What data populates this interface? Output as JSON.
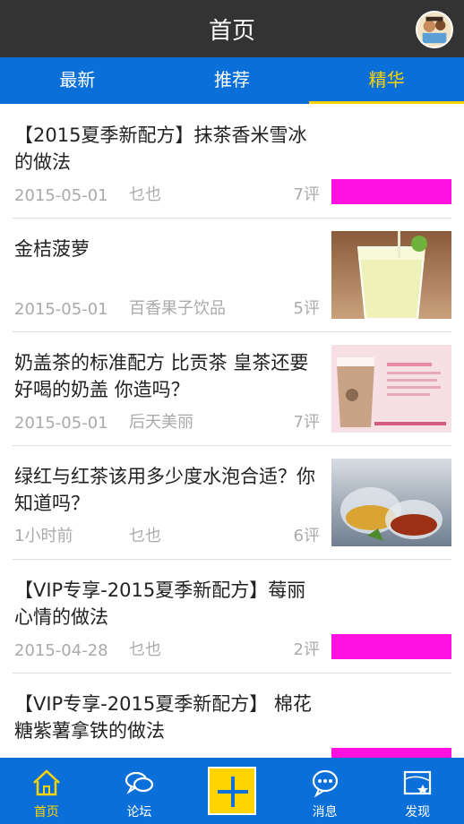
{
  "header": {
    "title": "首页"
  },
  "tabs": [
    {
      "label": "最新",
      "active": false
    },
    {
      "label": "推荐",
      "active": false
    },
    {
      "label": "精华",
      "active": true
    }
  ],
  "articles": [
    {
      "title": "【2015夏季新配方】抹茶香米雪冰的做法",
      "date": "2015-05-01",
      "author": "乜也",
      "comments": "7评",
      "thumb": "magenta-bar"
    },
    {
      "title": "金桔菠萝",
      "date": "2015-05-01",
      "author": "百香果子饮品",
      "comments": "5评",
      "thumb": "lemon-drink"
    },
    {
      "title": "奶盖茶的标准配方 比贡茶 皇茶还要好喝的奶盖 你造吗？",
      "date": "2015-05-01",
      "author": "后天美丽",
      "comments": "7评",
      "thumb": "milk-tea-poster"
    },
    {
      "title": "绿红与红茶该用多少度水泡合适？你知道吗？",
      "date": "1小时前",
      "author": "乜也",
      "comments": "6评",
      "thumb": "tea-cups"
    },
    {
      "title": "【VIP专享-2015夏季新配方】莓丽心情的做法",
      "date": "2015-04-28",
      "author": "乜也",
      "comments": "2评",
      "thumb": "magenta-bar"
    },
    {
      "title": "【VIP专享-2015夏季新配方】 棉花糖紫薯拿铁的做法",
      "date": "",
      "author": "",
      "comments": "",
      "thumb": "magenta-bar"
    }
  ],
  "bottom_nav": [
    {
      "label": "首页",
      "icon": "home-icon",
      "active": true
    },
    {
      "label": "论坛",
      "icon": "forum-icon"
    },
    {
      "label": "",
      "icon": "plus-icon"
    },
    {
      "label": "消息",
      "icon": "message-icon"
    },
    {
      "label": "发现",
      "icon": "discover-icon"
    }
  ],
  "colors": {
    "topbar": "#333333",
    "accent": "#0a6fd8",
    "highlight": "#ffd400",
    "thumb_magenta": "#ff10e0"
  }
}
